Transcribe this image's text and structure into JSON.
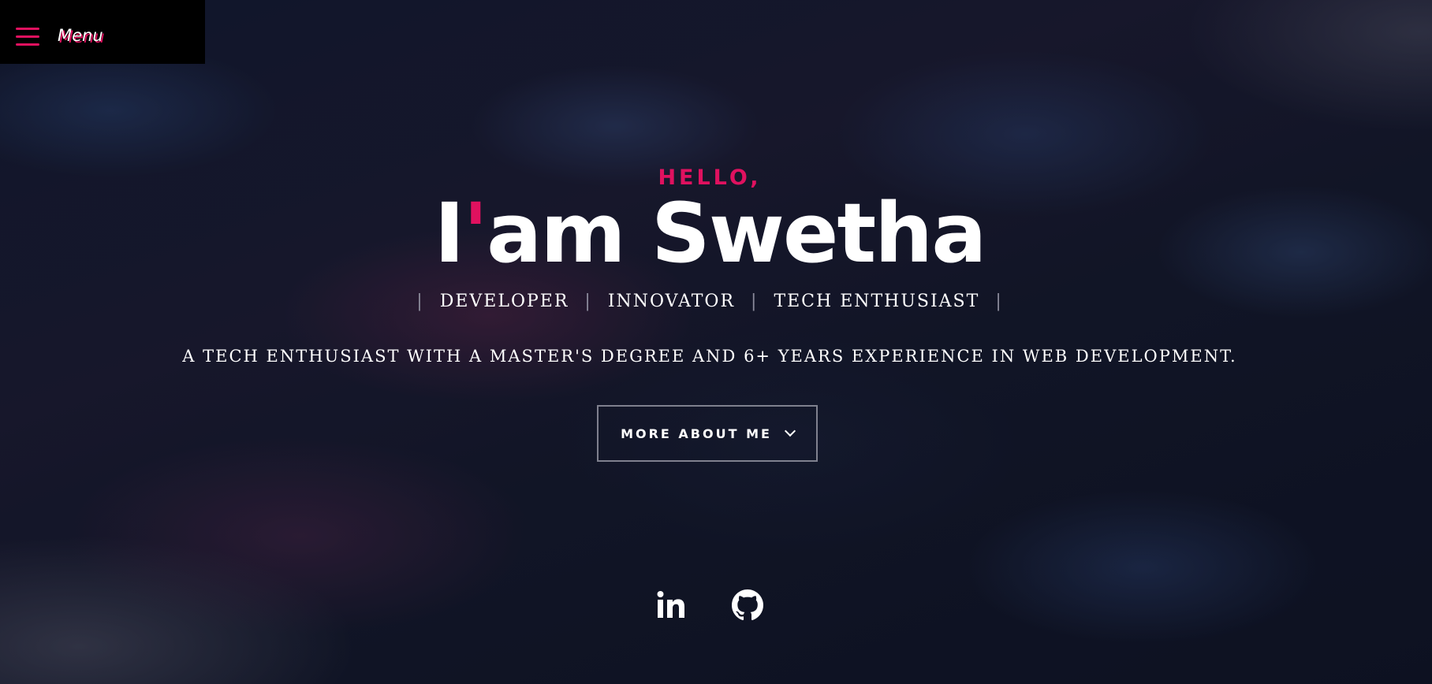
{
  "menu": {
    "label": "Menu",
    "icon": "hamburger-icon"
  },
  "hero": {
    "greeting": "HELLO,",
    "name_prefix": "I",
    "name_apostrophe": "'",
    "name_rest": "am Swetha",
    "roles": [
      "DEVELOPER",
      "INNOVATOR",
      "TECH ENTHUSIAST"
    ],
    "tagline": "A TECH ENTHUSIAST WITH A MASTER'S DEGREE AND 6+ YEARS EXPERIENCE IN WEB DEVELOPMENT.",
    "cta_label": "MORE ABOUT ME"
  },
  "social": [
    {
      "name": "LinkedIn",
      "icon": "linkedin-icon"
    },
    {
      "name": "GitHub",
      "icon": "github-icon"
    }
  ],
  "colors": {
    "accent": "#e0115f",
    "text": "#ffffff",
    "menu_bg": "#000000"
  }
}
